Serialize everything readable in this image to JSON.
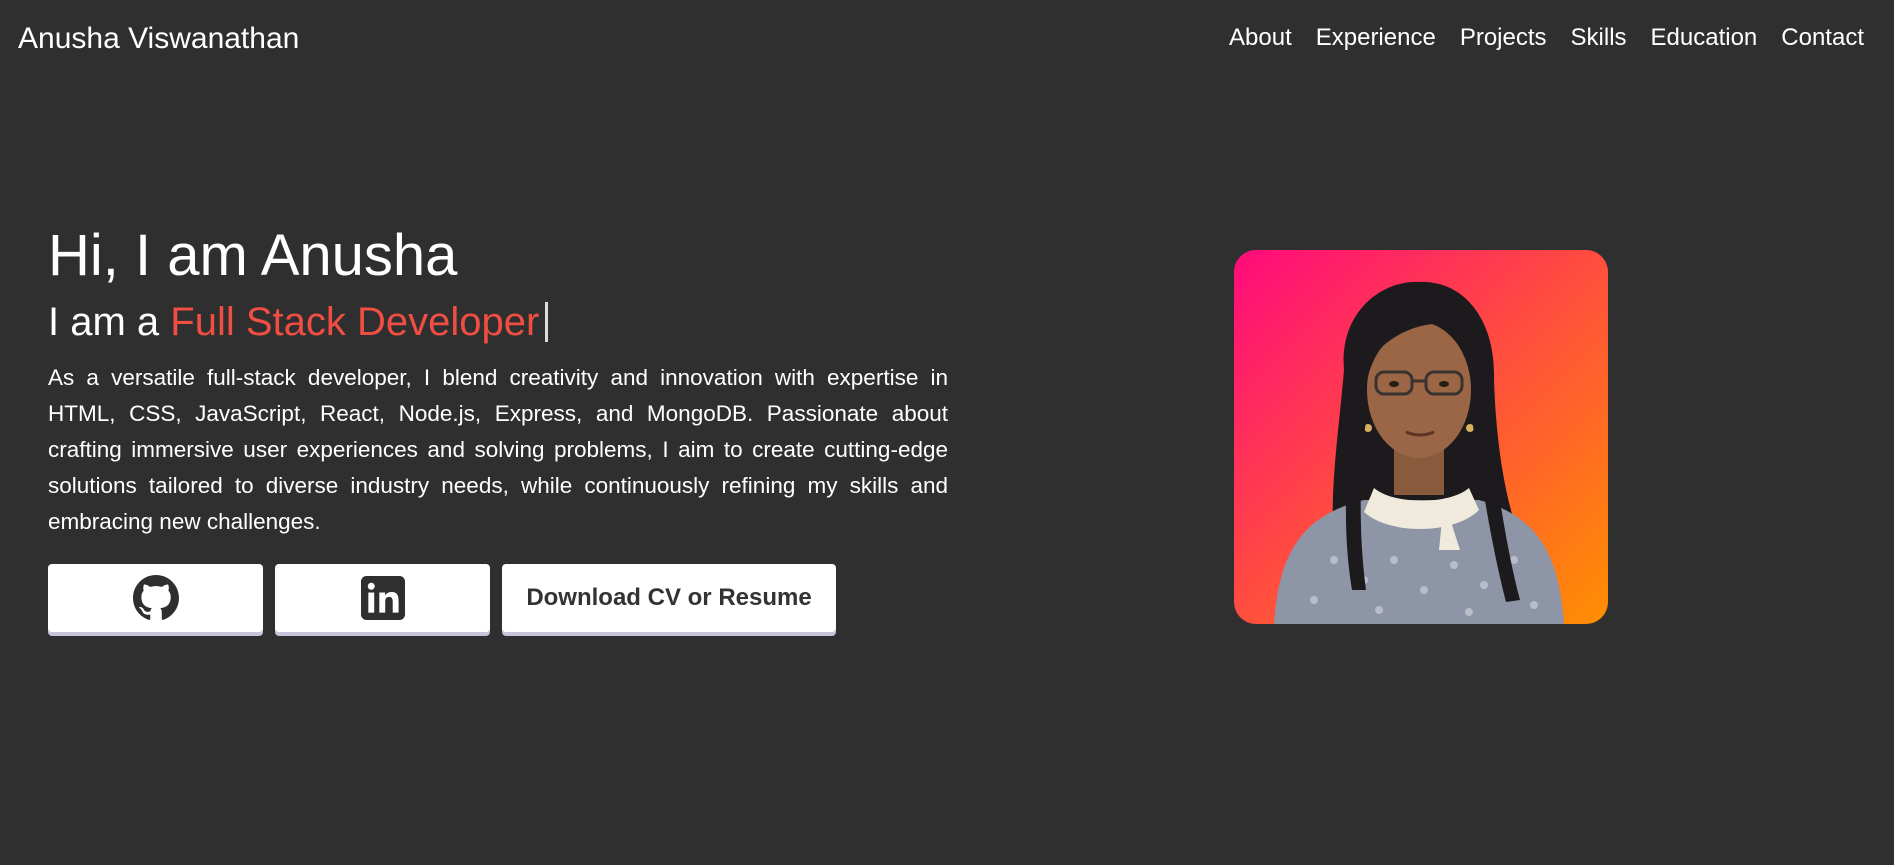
{
  "nav": {
    "brand": "Anusha Viswanathan",
    "links": [
      "About",
      "Experience",
      "Projects",
      "Skills",
      "Education",
      "Contact"
    ]
  },
  "hero": {
    "greeting": "Hi, I am Anusha",
    "role_prefix": "I am a ",
    "role": "Full Stack Developer",
    "bio": "As a versatile full-stack developer, I blend creativity and innovation with expertise in HTML, CSS, JavaScript, React, Node.js, Express, and MongoDB. Passionate about crafting immersive user experiences and solving problems, I aim to create cutting-edge solutions tailored to diverse industry needs, while continuously refining my skills and embracing new challenges.",
    "buttons": {
      "github_icon": "github-icon",
      "linkedin_icon": "linkedin-icon",
      "cv_label": "Download CV or Resume"
    },
    "photo_subject": "portrait-photo"
  },
  "colors": {
    "background": "#2f2f2f",
    "accent": "#f04d43",
    "text": "#ffffff",
    "button_bg": "#ffffff",
    "gradient_start": "#ff0a7c",
    "gradient_end": "#ff8f00"
  }
}
